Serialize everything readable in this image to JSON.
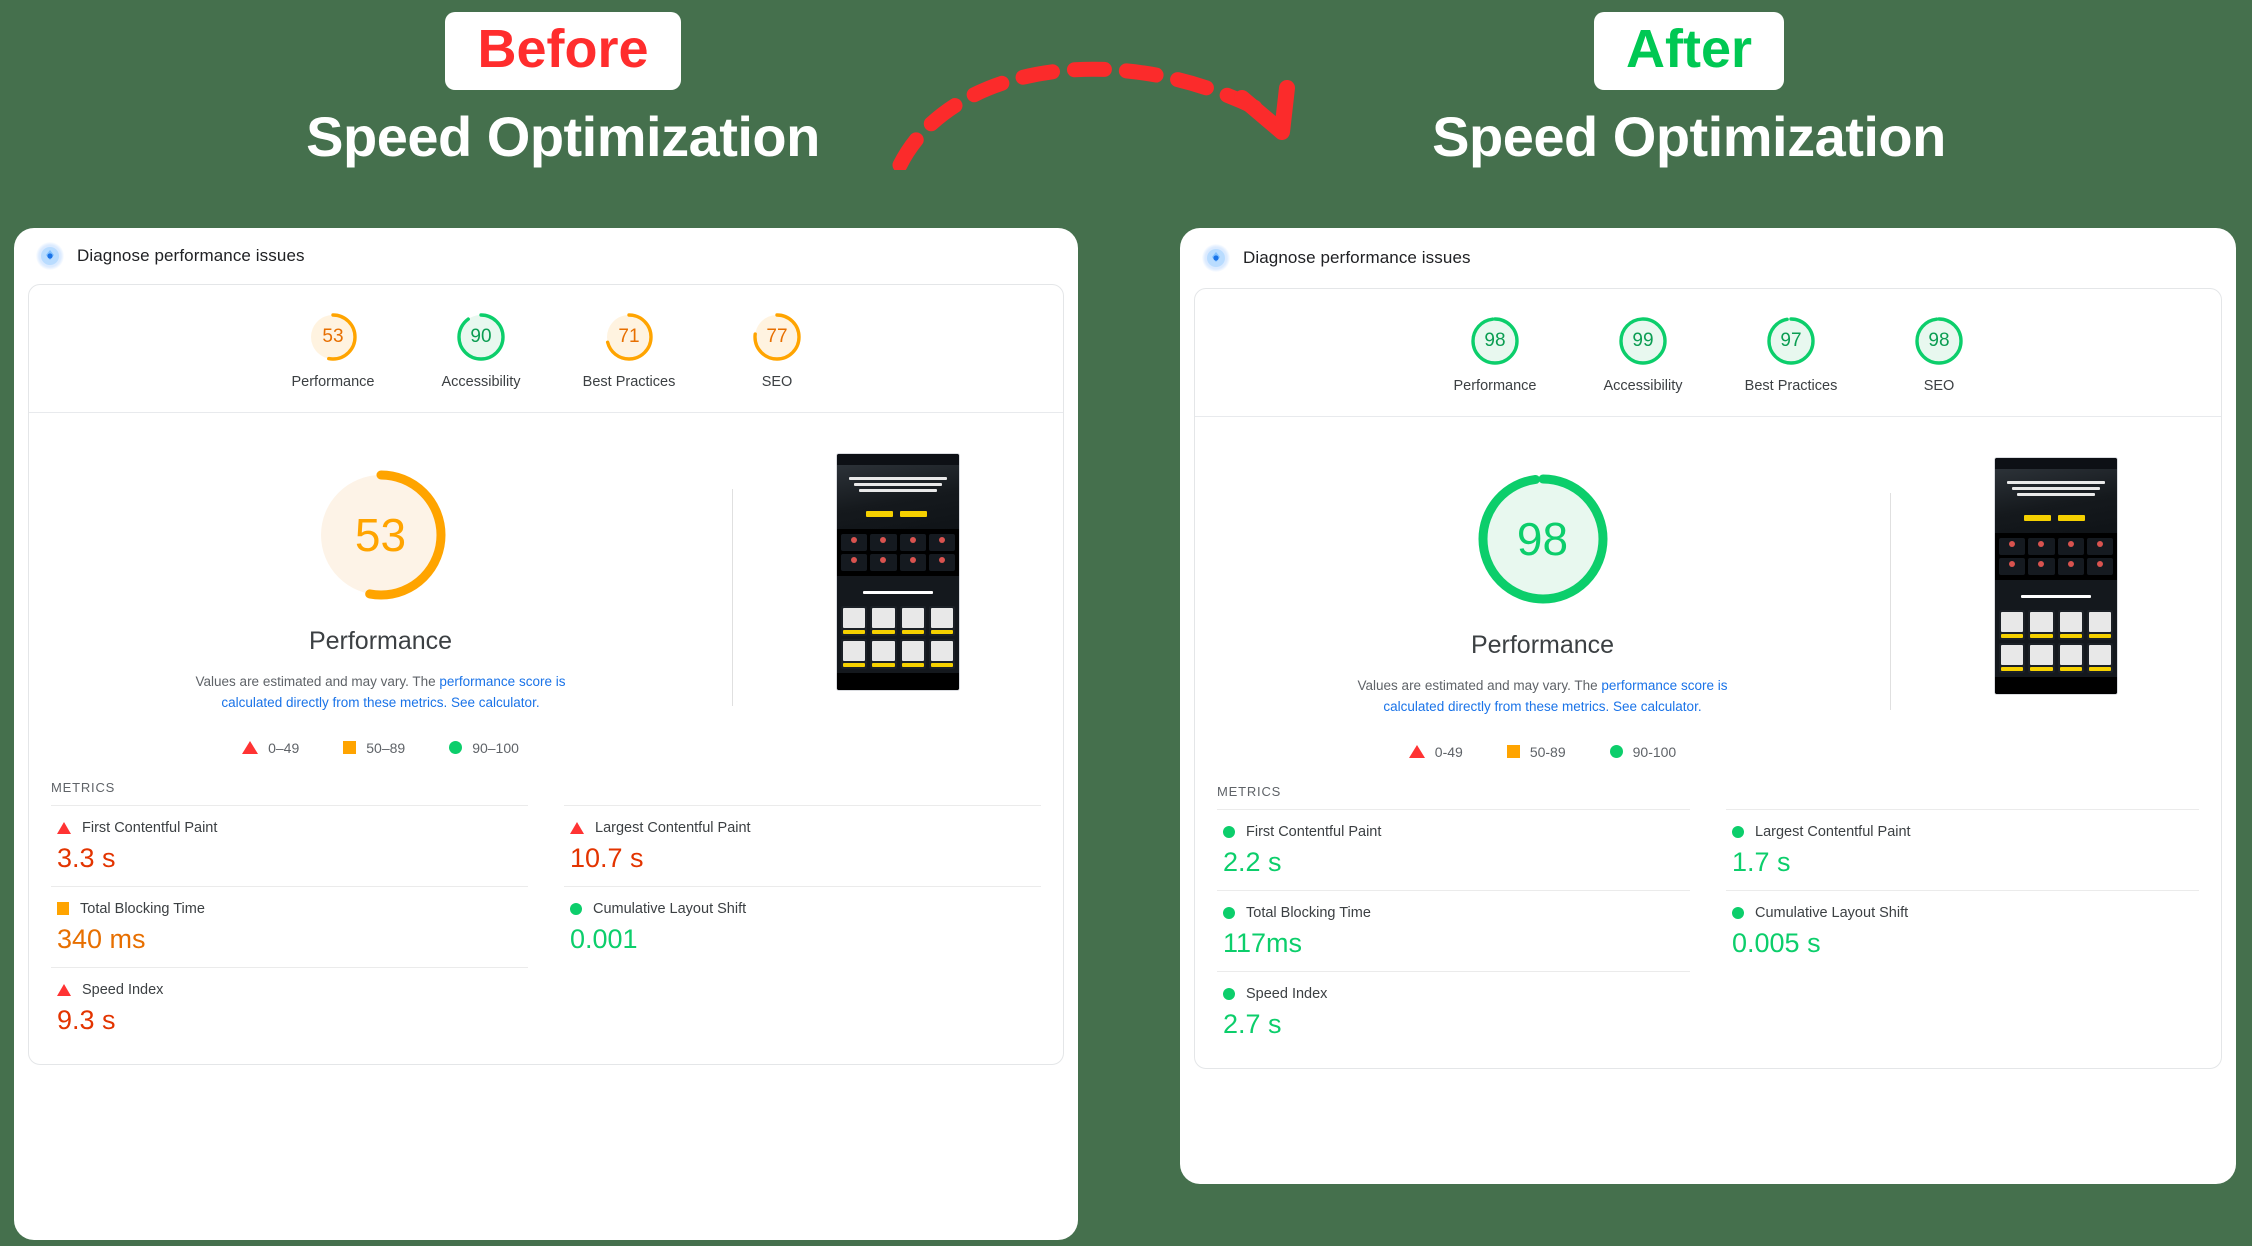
{
  "background_color": "#45704d",
  "headers": {
    "before": {
      "badge": "Before",
      "badge_color": "#ff2d2d",
      "title": "Speed Optimization"
    },
    "after": {
      "badge": "After",
      "badge_color": "#00c853",
      "title": "Speed Optimization"
    }
  },
  "arrow": {
    "name": "curved-dashed-arrow",
    "color": "#fb2b2b"
  },
  "panels": {
    "before": {
      "head_title": "Diagnose performance issues",
      "gauges": [
        {
          "label": "Performance",
          "value": "53",
          "color": "#ffa400",
          "track": "#fff3e0"
        },
        {
          "label": "Accessibility",
          "value": "90",
          "color": "#0cce6b",
          "track": "#e8f8ef"
        },
        {
          "label": "Best Practices",
          "value": "71",
          "color": "#ffa400",
          "track": "#fff3e0"
        },
        {
          "label": "SEO",
          "value": "77",
          "color": "#ffa400",
          "track": "#fff3e0"
        }
      ],
      "big_gauge": {
        "value": "53",
        "label": "Performance",
        "color": "#ffa400",
        "track": "#fdf3e7"
      },
      "note_1": "Values are estimated and may vary. The ",
      "note_link_1": "performance score is calculated directly from these metrics.",
      "note_link_2": "See calculator.",
      "legend": [
        {
          "shape": "triangle",
          "label": "0–49",
          "color": "#ff3333"
        },
        {
          "shape": "square",
          "label": "50–89",
          "color": "#ffa400"
        },
        {
          "shape": "circle",
          "label": "90–100",
          "color": "#0cce6b"
        }
      ],
      "metrics_heading": "METRICS",
      "metrics_left": [
        {
          "shape": "triangle",
          "name": "First Contentful Paint",
          "value": "3.3 s",
          "value_color": "red"
        },
        {
          "shape": "square",
          "name": "Total Blocking Time",
          "value": "340 ms",
          "value_color": "orange"
        },
        {
          "shape": "triangle",
          "name": "Speed Index",
          "value": "9.3 s",
          "value_color": "red"
        }
      ],
      "metrics_right": [
        {
          "shape": "triangle",
          "name": "Largest Contentful Paint",
          "value": "10.7 s",
          "value_color": "red"
        },
        {
          "shape": "circle",
          "name": "Cumulative Layout Shift",
          "value": "0.001",
          "value_color": "green"
        }
      ]
    },
    "after": {
      "head_title": "Diagnose performance issues",
      "gauges": [
        {
          "label": "Performance",
          "value": "98",
          "color": "#0cce6b",
          "track": "#e8f8ef"
        },
        {
          "label": "Accessibility",
          "value": "99",
          "color": "#0cce6b",
          "track": "#e8f8ef"
        },
        {
          "label": "Best Practices",
          "value": "97",
          "color": "#0cce6b",
          "track": "#e8f8ef"
        },
        {
          "label": "SEO",
          "value": "98",
          "color": "#0cce6b",
          "track": "#e8f8ef"
        }
      ],
      "big_gauge": {
        "value": "98",
        "label": "Performance",
        "color": "#0cce6b",
        "track": "#e8f8ef"
      },
      "note_1": "Values are estimated and may vary. The ",
      "note_link_1": "performance score is calculated directly from these metrics.",
      "note_link_2": "See calculator.",
      "legend": [
        {
          "shape": "triangle",
          "label": "0-49",
          "color": "#ff3333"
        },
        {
          "shape": "square",
          "label": "50-89",
          "color": "#ffa400"
        },
        {
          "shape": "circle",
          "label": "90-100",
          "color": "#0cce6b"
        }
      ],
      "metrics_heading": "METRICS",
      "metrics_left": [
        {
          "shape": "circle",
          "name": "First Contentful Paint",
          "value": "2.2 s",
          "value_color": "green"
        },
        {
          "shape": "circle",
          "name": "Total Blocking Time",
          "value": "117ms",
          "value_color": "green"
        },
        {
          "shape": "circle",
          "name": "Speed Index",
          "value": "2.7 s",
          "value_color": "green"
        }
      ],
      "metrics_right": [
        {
          "shape": "circle",
          "name": "Largest Contentful Paint",
          "value": "1.7 s",
          "value_color": "green"
        },
        {
          "shape": "circle",
          "name": "Cumulative Layout Shift",
          "value": "0.005 s",
          "value_color": "green"
        }
      ]
    }
  }
}
